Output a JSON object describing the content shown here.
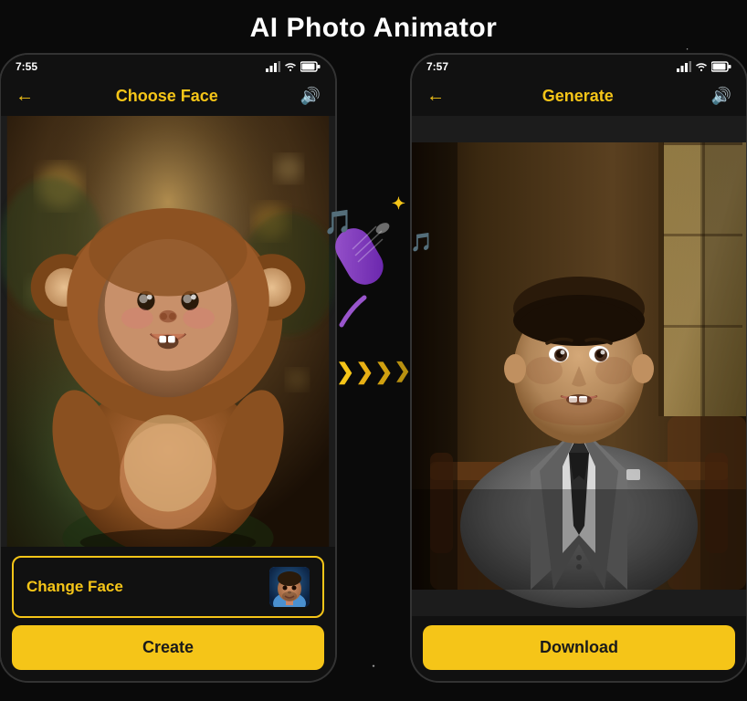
{
  "page": {
    "title": "AI Photo Animator"
  },
  "phone_left": {
    "status_time": "7:55",
    "header_title": "Choose Face",
    "change_face_label": "Change Face",
    "create_label": "Create"
  },
  "phone_right": {
    "status_time": "7:57",
    "header_title": "Generate",
    "download_label": "Download"
  },
  "icons": {
    "back_arrow": "←",
    "sound": "🔊",
    "music_note_1": "🎵",
    "music_note_2": "🎶",
    "sparkle": "✦",
    "arrow_chevron": "❯"
  }
}
